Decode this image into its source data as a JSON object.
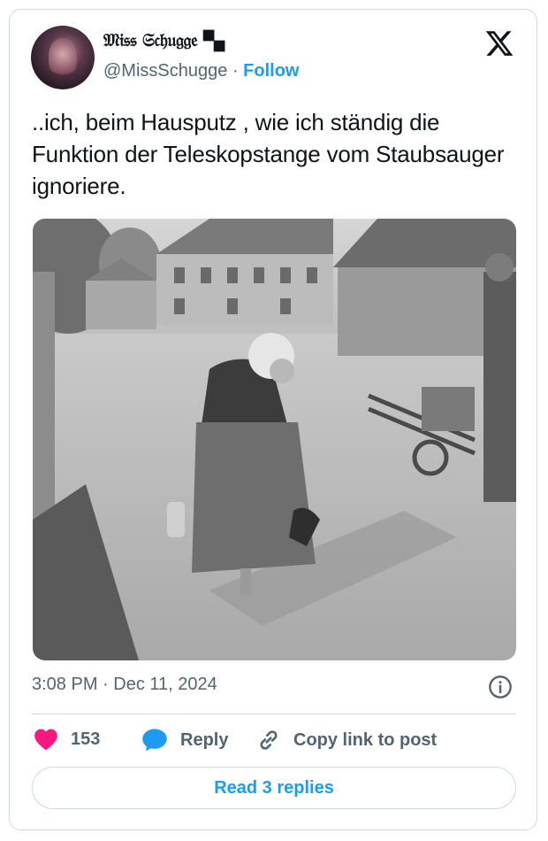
{
  "author": {
    "display_name": "𝔐𝔦𝔰𝔰 𝔖𝔠𝔥𝔲𝔤𝔤𝔢 🙿",
    "handle": "@MissSchugge",
    "separator": "·",
    "follow_label": "Follow"
  },
  "tweet": {
    "text": "..ich, beim Hausputz , wie ich ständig die Funktion der Teleskopstange vom Staubsauger ignoriere.",
    "timestamp": "3:08 PM · Dec 11, 2024"
  },
  "actions": {
    "like_count": "153",
    "reply_label": "Reply",
    "copy_link_label": "Copy link to post",
    "read_replies_label": "Read 3 replies"
  },
  "colors": {
    "accent": "#1d9bf0",
    "like": "#f91880",
    "muted": "#536471",
    "border": "#cfd9de"
  },
  "icons": {
    "brand": "x-logo-icon",
    "info": "info-icon",
    "like": "heart-icon",
    "reply": "speech-bubble-icon",
    "copy": "link-icon"
  }
}
